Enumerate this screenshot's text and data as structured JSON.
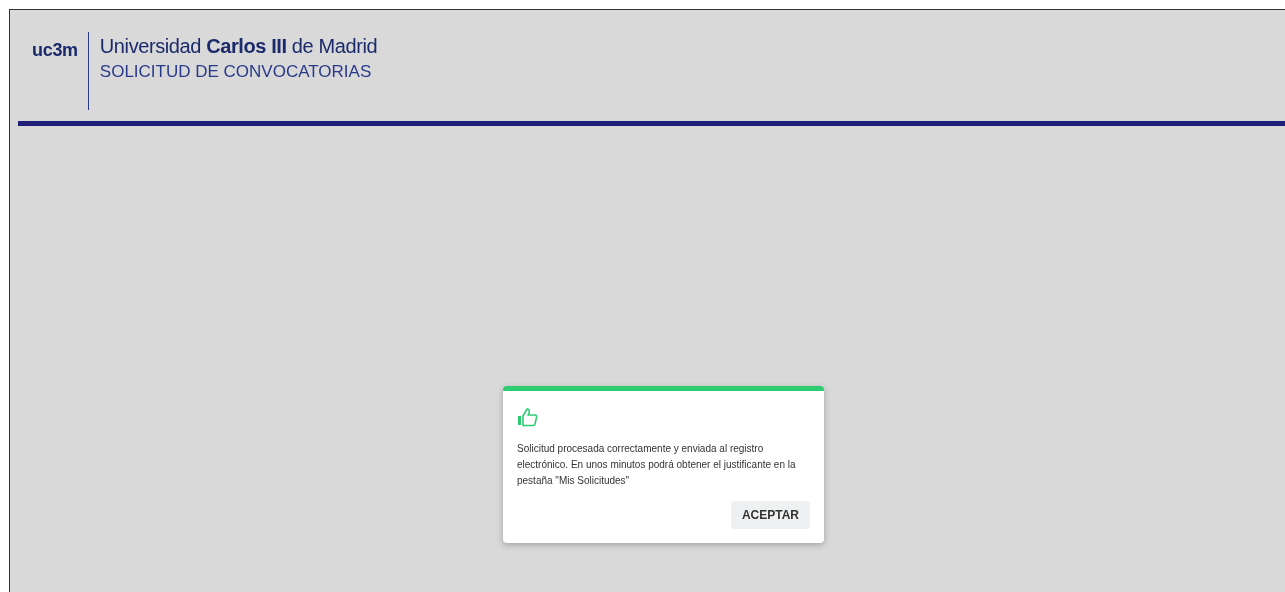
{
  "header": {
    "logo": "uc3m",
    "title": "Universidad **Carlos III** de Madrid",
    "subtitle": "SOLICITUD DE CONVOCATORIAS"
  },
  "dialog": {
    "message": "Solicitud procesada correctamente y enviada al registro electrónico. En unos minutos podrá obtener el justificante en la pestaña \"Mis Solicitudes\"",
    "buttons": [
      "ACEPTAR"
    ]
  }
}
